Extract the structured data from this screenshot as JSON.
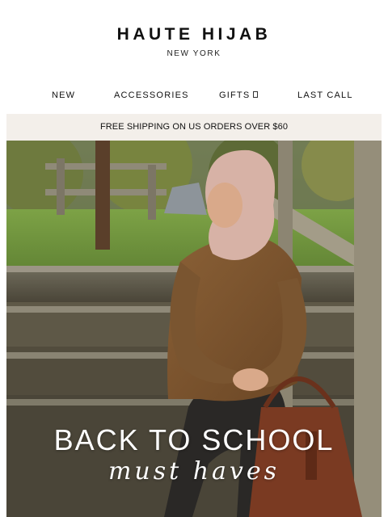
{
  "brand": {
    "name": "HAUTE HIJAB",
    "location": "NEW YORK"
  },
  "nav": {
    "items": [
      {
        "label": "NEW"
      },
      {
        "label": "ACCESSORIES"
      },
      {
        "label": "GIFTS",
        "icon": "chevron-down-icon"
      },
      {
        "label": "LAST CALL"
      }
    ]
  },
  "banner": {
    "text": "FREE SHIPPING ON US ORDERS OVER $60"
  },
  "hero": {
    "title": "BACK TO SCHOOL",
    "subtitle": "must haves"
  }
}
